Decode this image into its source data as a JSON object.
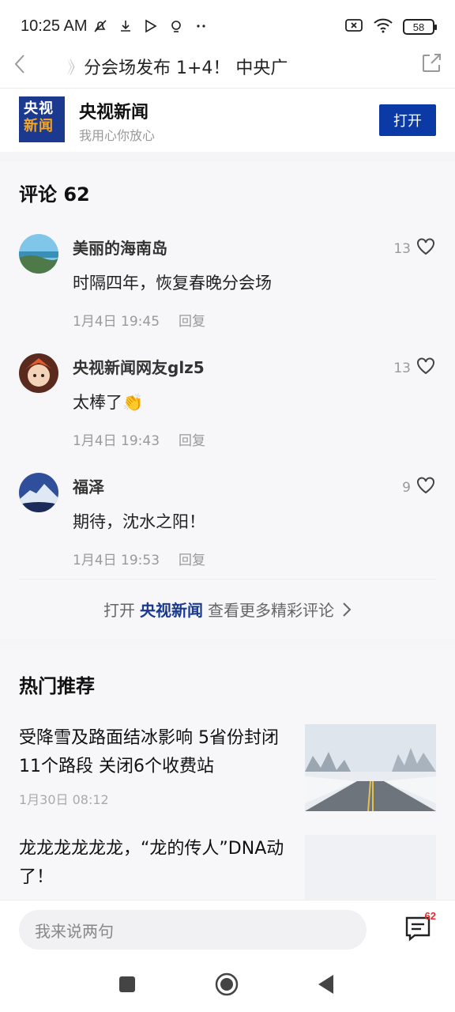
{
  "status_bar": {
    "time": "10:25 AM",
    "icons": [
      "mute-icon",
      "download-icon",
      "play-store-icon",
      "location-icon",
      "more-dots-icon"
    ],
    "right_icons": [
      "sim-off-icon",
      "wifi-icon"
    ],
    "battery": "58"
  },
  "nav": {
    "title": "》分会场发布      1+4！ 中央广"
  },
  "app_banner": {
    "logo_line1": "央视",
    "logo_line2": "新闻",
    "name": "央视新闻",
    "slogan": "我用心你放心",
    "open_label": "打开"
  },
  "comments_section": {
    "title": "评论 62",
    "items": [
      {
        "author": "美丽的海南岛",
        "text": "时隔四年，恢复春晚分会场",
        "date": "1月4日 19:45",
        "reply": "回复",
        "likes": "13"
      },
      {
        "author": "央视新闻网友glz5",
        "text": "太棒了👏",
        "date": "1月4日 19:43",
        "reply": "回复",
        "likes": "13"
      },
      {
        "author": "福泽",
        "text": "期待，沈水之阳！",
        "date": "1月4日 19:53",
        "reply": "回复",
        "likes": "9"
      }
    ],
    "more": {
      "prefix": "打开",
      "brand": "央视新闻",
      "suffix": "查看更多精彩评论"
    }
  },
  "hot_section": {
    "title": "热门推荐",
    "items": [
      {
        "title": "受降雪及路面结冰影响 5省份封闭11个路段 关闭6个收费站",
        "time": "1月30日 08:12"
      },
      {
        "title": "龙龙龙龙龙龙，“龙的传人”DNA动了！",
        "time": ""
      }
    ]
  },
  "bottom_bar": {
    "comment_placeholder": "我来说两句",
    "comment_count": "62"
  }
}
